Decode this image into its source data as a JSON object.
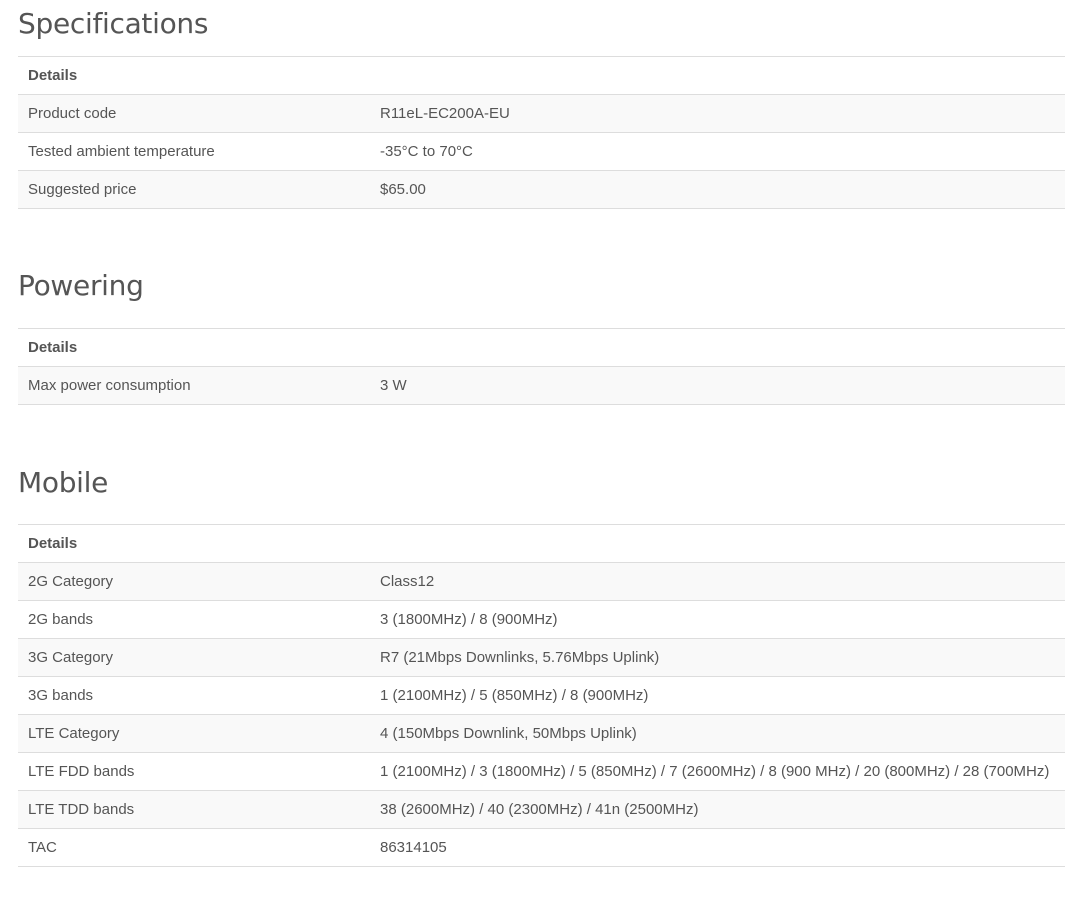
{
  "sections": [
    {
      "title": "Specifications",
      "header": "Details",
      "rows": [
        {
          "label": "Product code",
          "value": "R11eL-EC200A-EU"
        },
        {
          "label": "Tested ambient temperature",
          "value": "-35°C to 70°C"
        },
        {
          "label": "Suggested price",
          "value": "$65.00"
        }
      ]
    },
    {
      "title": "Powering",
      "header": "Details",
      "rows": [
        {
          "label": "Max power consumption",
          "value": "3 W"
        }
      ]
    },
    {
      "title": "Mobile",
      "header": "Details",
      "rows": [
        {
          "label": "2G Category",
          "value": "Class12"
        },
        {
          "label": "2G bands",
          "value": "3 (1800MHz) / 8 (900MHz)"
        },
        {
          "label": "3G Category",
          "value": "R7 (21Mbps Downlinks, 5.76Mbps Uplink)"
        },
        {
          "label": "3G bands",
          "value": "1 (2100MHz) / 5 (850MHz) / 8 (900MHz)"
        },
        {
          "label": "LTE Category",
          "value": "4 (150Mbps Downlink, 50Mbps Uplink)"
        },
        {
          "label": "LTE FDD bands",
          "value": "1 (2100MHz) / 3 (1800MHz) / 5 (850MHz) / 7 (2600MHz) / 8 (900 MHz) / 20 (800MHz) / 28 (700MHz)"
        },
        {
          "label": "LTE TDD bands",
          "value": "38 (2600MHz) / 40 (2300MHz) / 41n (2500MHz)"
        },
        {
          "label": "TAC",
          "value": "86314105"
        }
      ]
    }
  ]
}
